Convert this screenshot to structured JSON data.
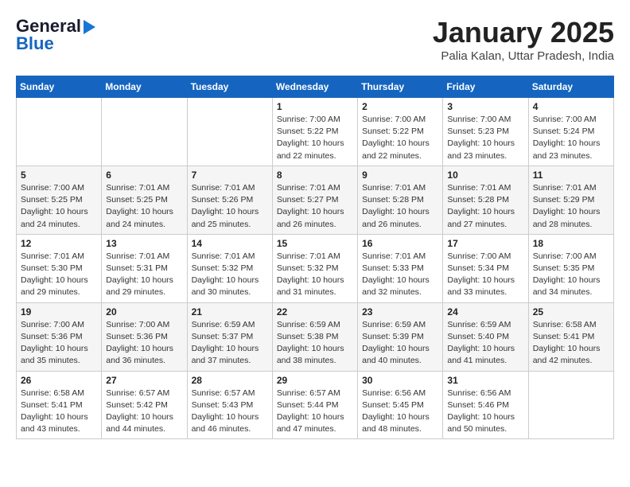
{
  "logo": {
    "line1": "General",
    "line2": "Blue",
    "arrow": "▶"
  },
  "title": "January 2025",
  "subtitle": "Palia Kalan, Uttar Pradesh, India",
  "weekdays": [
    "Sunday",
    "Monday",
    "Tuesday",
    "Wednesday",
    "Thursday",
    "Friday",
    "Saturday"
  ],
  "weeks": [
    [
      {
        "day": "",
        "info": ""
      },
      {
        "day": "",
        "info": ""
      },
      {
        "day": "",
        "info": ""
      },
      {
        "day": "1",
        "info": "Sunrise: 7:00 AM\nSunset: 5:22 PM\nDaylight: 10 hours\nand 22 minutes."
      },
      {
        "day": "2",
        "info": "Sunrise: 7:00 AM\nSunset: 5:22 PM\nDaylight: 10 hours\nand 22 minutes."
      },
      {
        "day": "3",
        "info": "Sunrise: 7:00 AM\nSunset: 5:23 PM\nDaylight: 10 hours\nand 23 minutes."
      },
      {
        "day": "4",
        "info": "Sunrise: 7:00 AM\nSunset: 5:24 PM\nDaylight: 10 hours\nand 23 minutes."
      }
    ],
    [
      {
        "day": "5",
        "info": "Sunrise: 7:00 AM\nSunset: 5:25 PM\nDaylight: 10 hours\nand 24 minutes."
      },
      {
        "day": "6",
        "info": "Sunrise: 7:01 AM\nSunset: 5:25 PM\nDaylight: 10 hours\nand 24 minutes."
      },
      {
        "day": "7",
        "info": "Sunrise: 7:01 AM\nSunset: 5:26 PM\nDaylight: 10 hours\nand 25 minutes."
      },
      {
        "day": "8",
        "info": "Sunrise: 7:01 AM\nSunset: 5:27 PM\nDaylight: 10 hours\nand 26 minutes."
      },
      {
        "day": "9",
        "info": "Sunrise: 7:01 AM\nSunset: 5:28 PM\nDaylight: 10 hours\nand 26 minutes."
      },
      {
        "day": "10",
        "info": "Sunrise: 7:01 AM\nSunset: 5:28 PM\nDaylight: 10 hours\nand 27 minutes."
      },
      {
        "day": "11",
        "info": "Sunrise: 7:01 AM\nSunset: 5:29 PM\nDaylight: 10 hours\nand 28 minutes."
      }
    ],
    [
      {
        "day": "12",
        "info": "Sunrise: 7:01 AM\nSunset: 5:30 PM\nDaylight: 10 hours\nand 29 minutes."
      },
      {
        "day": "13",
        "info": "Sunrise: 7:01 AM\nSunset: 5:31 PM\nDaylight: 10 hours\nand 29 minutes."
      },
      {
        "day": "14",
        "info": "Sunrise: 7:01 AM\nSunset: 5:32 PM\nDaylight: 10 hours\nand 30 minutes."
      },
      {
        "day": "15",
        "info": "Sunrise: 7:01 AM\nSunset: 5:32 PM\nDaylight: 10 hours\nand 31 minutes."
      },
      {
        "day": "16",
        "info": "Sunrise: 7:01 AM\nSunset: 5:33 PM\nDaylight: 10 hours\nand 32 minutes."
      },
      {
        "day": "17",
        "info": "Sunrise: 7:00 AM\nSunset: 5:34 PM\nDaylight: 10 hours\nand 33 minutes."
      },
      {
        "day": "18",
        "info": "Sunrise: 7:00 AM\nSunset: 5:35 PM\nDaylight: 10 hours\nand 34 minutes."
      }
    ],
    [
      {
        "day": "19",
        "info": "Sunrise: 7:00 AM\nSunset: 5:36 PM\nDaylight: 10 hours\nand 35 minutes."
      },
      {
        "day": "20",
        "info": "Sunrise: 7:00 AM\nSunset: 5:36 PM\nDaylight: 10 hours\nand 36 minutes."
      },
      {
        "day": "21",
        "info": "Sunrise: 6:59 AM\nSunset: 5:37 PM\nDaylight: 10 hours\nand 37 minutes."
      },
      {
        "day": "22",
        "info": "Sunrise: 6:59 AM\nSunset: 5:38 PM\nDaylight: 10 hours\nand 38 minutes."
      },
      {
        "day": "23",
        "info": "Sunrise: 6:59 AM\nSunset: 5:39 PM\nDaylight: 10 hours\nand 40 minutes."
      },
      {
        "day": "24",
        "info": "Sunrise: 6:59 AM\nSunset: 5:40 PM\nDaylight: 10 hours\nand 41 minutes."
      },
      {
        "day": "25",
        "info": "Sunrise: 6:58 AM\nSunset: 5:41 PM\nDaylight: 10 hours\nand 42 minutes."
      }
    ],
    [
      {
        "day": "26",
        "info": "Sunrise: 6:58 AM\nSunset: 5:41 PM\nDaylight: 10 hours\nand 43 minutes."
      },
      {
        "day": "27",
        "info": "Sunrise: 6:57 AM\nSunset: 5:42 PM\nDaylight: 10 hours\nand 44 minutes."
      },
      {
        "day": "28",
        "info": "Sunrise: 6:57 AM\nSunset: 5:43 PM\nDaylight: 10 hours\nand 46 minutes."
      },
      {
        "day": "29",
        "info": "Sunrise: 6:57 AM\nSunset: 5:44 PM\nDaylight: 10 hours\nand 47 minutes."
      },
      {
        "day": "30",
        "info": "Sunrise: 6:56 AM\nSunset: 5:45 PM\nDaylight: 10 hours\nand 48 minutes."
      },
      {
        "day": "31",
        "info": "Sunrise: 6:56 AM\nSunset: 5:46 PM\nDaylight: 10 hours\nand 50 minutes."
      },
      {
        "day": "",
        "info": ""
      }
    ]
  ]
}
